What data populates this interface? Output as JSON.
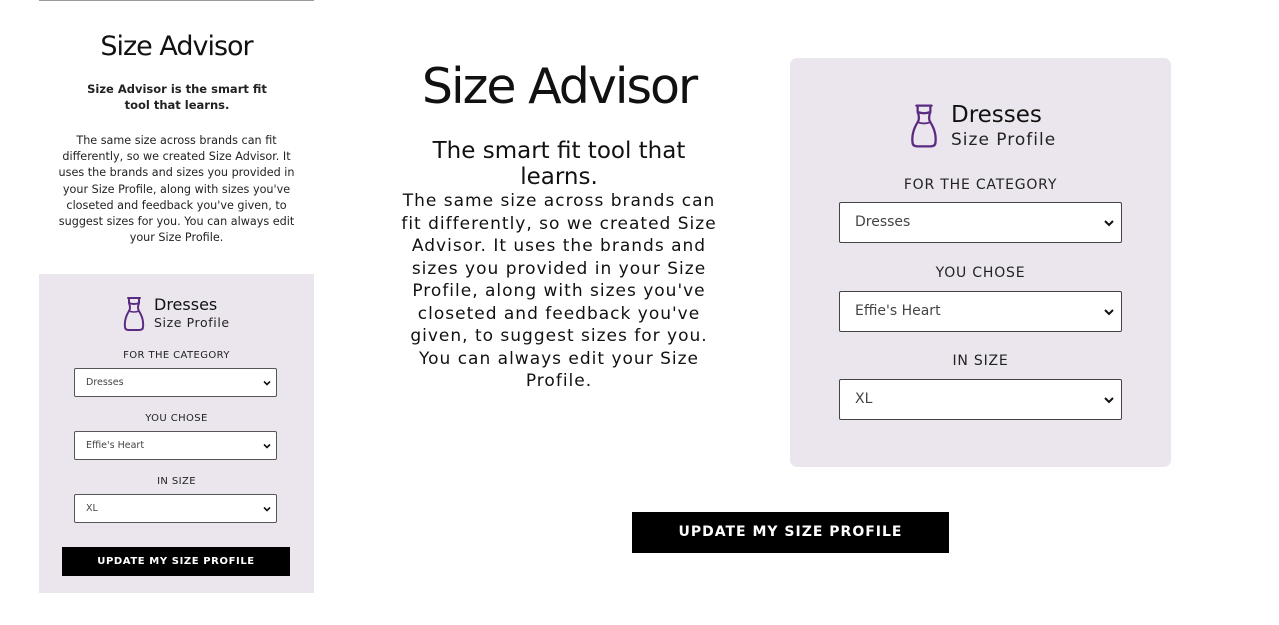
{
  "colors": {
    "panel_bg": "#ebe6ee",
    "dress_icon": "#5b2b82",
    "button_bg": "#000000",
    "button_text": "#ffffff"
  },
  "mobile": {
    "title": "Size Advisor",
    "tagline": "Size Advisor is the smart fit tool that learns.",
    "description": "The same size across brands can fit differently, so we created Size Advisor. It uses the brands and sizes you provided in your Size Profile, along with sizes you've closeted and feedback you've given, to suggest sizes for you. You can always edit your Size Profile.",
    "panel": {
      "icon": "dress-icon",
      "heading": "Dresses",
      "subheading": "Size Profile",
      "category_label": "FOR THE CATEGORY",
      "category_value": "Dresses",
      "chose_label": "YOU CHOSE",
      "chose_value": "Effie's Heart",
      "size_label": "IN SIZE",
      "size_value": "XL",
      "button_label": "UPDATE MY SIZE PROFILE"
    }
  },
  "desktop": {
    "title": "Size Advisor",
    "tagline": "The smart fit tool that learns.",
    "description": "The same size across brands can fit differently, so we created Size Advisor. It uses the brands and sizes you provided in your Size Profile, along with sizes you've closeted and feedback you've given, to suggest sizes for you. You can always edit your Size Profile.",
    "panel": {
      "icon": "dress-icon",
      "heading": "Dresses",
      "subheading": "Size Profile",
      "category_label": "FOR THE CATEGORY",
      "category_value": "Dresses",
      "chose_label": "YOU CHOSE",
      "chose_value": "Effie's Heart",
      "size_label": "IN SIZE",
      "size_value": "XL"
    },
    "button_label": "UPDATE MY SIZE PROFILE"
  }
}
